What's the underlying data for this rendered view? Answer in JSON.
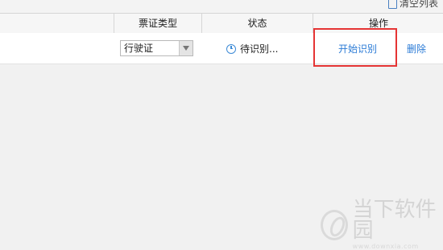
{
  "toolbar": {
    "clear_list": "清空列表",
    "clear_icon": "list-clear-icon"
  },
  "table": {
    "headers": {
      "ticket_type": "票证类型",
      "status": "状态",
      "action": "操作"
    },
    "row": {
      "ticket_type_value": "行驶证",
      "status_icon": "clock-icon",
      "status_text": "待识别...",
      "start_label": "开始识别",
      "delete_label": "删除"
    }
  },
  "watermark": {
    "title": "当下软件园",
    "url": "www.downxia.com"
  },
  "colors": {
    "link": "#2b7bd6",
    "highlight": "#e53434",
    "status_icon": "#3c8ad6"
  }
}
